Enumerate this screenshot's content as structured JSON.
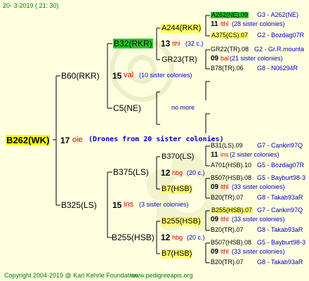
{
  "header": {
    "date": "20-  3-2019 (  21:  30)"
  },
  "footer": {
    "copyright": "Copyright 2004-2019 @ Karl Kehrle Foundation",
    "website": "www.pedigreeapis.org"
  },
  "root": {
    "name": "B262(WK)",
    "num": "17",
    "sub": "oie",
    "drones": "(Drones from 20 sister colonies)"
  },
  "gen1": [
    {
      "name": "B60(RKR)",
      "num": "15",
      "sub": "val",
      "note": "(10 sister colonies)"
    },
    {
      "name": "B325(LS)",
      "num": "15",
      "sub": "ins",
      "note": "(3 sister colonies)"
    }
  ],
  "gen2": [
    {
      "name": "B32(RKR)",
      "num": "13",
      "sub": "lthl",
      "note": "(32 c.)"
    },
    {
      "name": "C5(NE)",
      "num": "",
      "sub": "",
      "note": "no more"
    },
    {
      "name": "B375(LS)",
      "num": "12",
      "sub": "hbg",
      "note": "(20 c.)"
    },
    {
      "name": "B255(HSB)",
      "num": "12",
      "sub": "hbg",
      "note": "(20 c.)"
    }
  ],
  "gen3": [
    {
      "name": "A244(RKR)"
    },
    {
      "name": "GR23(TR)"
    },
    {
      "name": "B370(LS)"
    },
    {
      "name": "B7(HSB)"
    },
    {
      "name": "B255(HSB)"
    },
    {
      "name": "B7(HSB)"
    }
  ],
  "gen4": [
    {
      "name": "A262(NE).09",
      "ref": "G3 - A262(NE)",
      "num": "11",
      "sub": "lthl",
      "note": "(28 sister colonies)"
    },
    {
      "name": "A375(CS).07",
      "ref": "G2 - Bozdag07R"
    },
    {
      "name": "GR22(TR).08",
      "ref": "G2 - Gr.R.mounta",
      "num": "09",
      "sub": "bal",
      "note": "(21 sister colonies)"
    },
    {
      "name": "B78(TR).06",
      "ref": "G8 - N06294R"
    },
    {
      "name": "B31(LS).09",
      "ref": "G7 - Cankiri97Q",
      "num": "11",
      "sub": "ins",
      "note": "(2 sister colonies)"
    },
    {
      "name": "A701(HSB).10",
      "ref": "G5 - Bozdag07R"
    },
    {
      "name": "B507(HSB).08",
      "ref": "G5 - Bayburt98-3",
      "num": "09",
      "sub": "lthl",
      "note": "(33 sister colonies)"
    },
    {
      "name": "B20(TR).07",
      "ref": "G8 - Takab93aR"
    },
    {
      "name": "B255(HSB).07",
      "ref": "G7 - Cankiri97Q",
      "num": "09",
      "sub": "lthl",
      "note": "(33 sister colonies)"
    },
    {
      "name": "B20(TR).07",
      "ref": "G8 - Takab93aR"
    },
    {
      "name": "B507(HSB).08",
      "ref": "G5 - Bayburt98-3",
      "num": "09",
      "sub": "lthl",
      "note": "(33 sister colonies)"
    },
    {
      "name": "B20(TR).07",
      "ref": "G8 - Takab93aR"
    }
  ]
}
